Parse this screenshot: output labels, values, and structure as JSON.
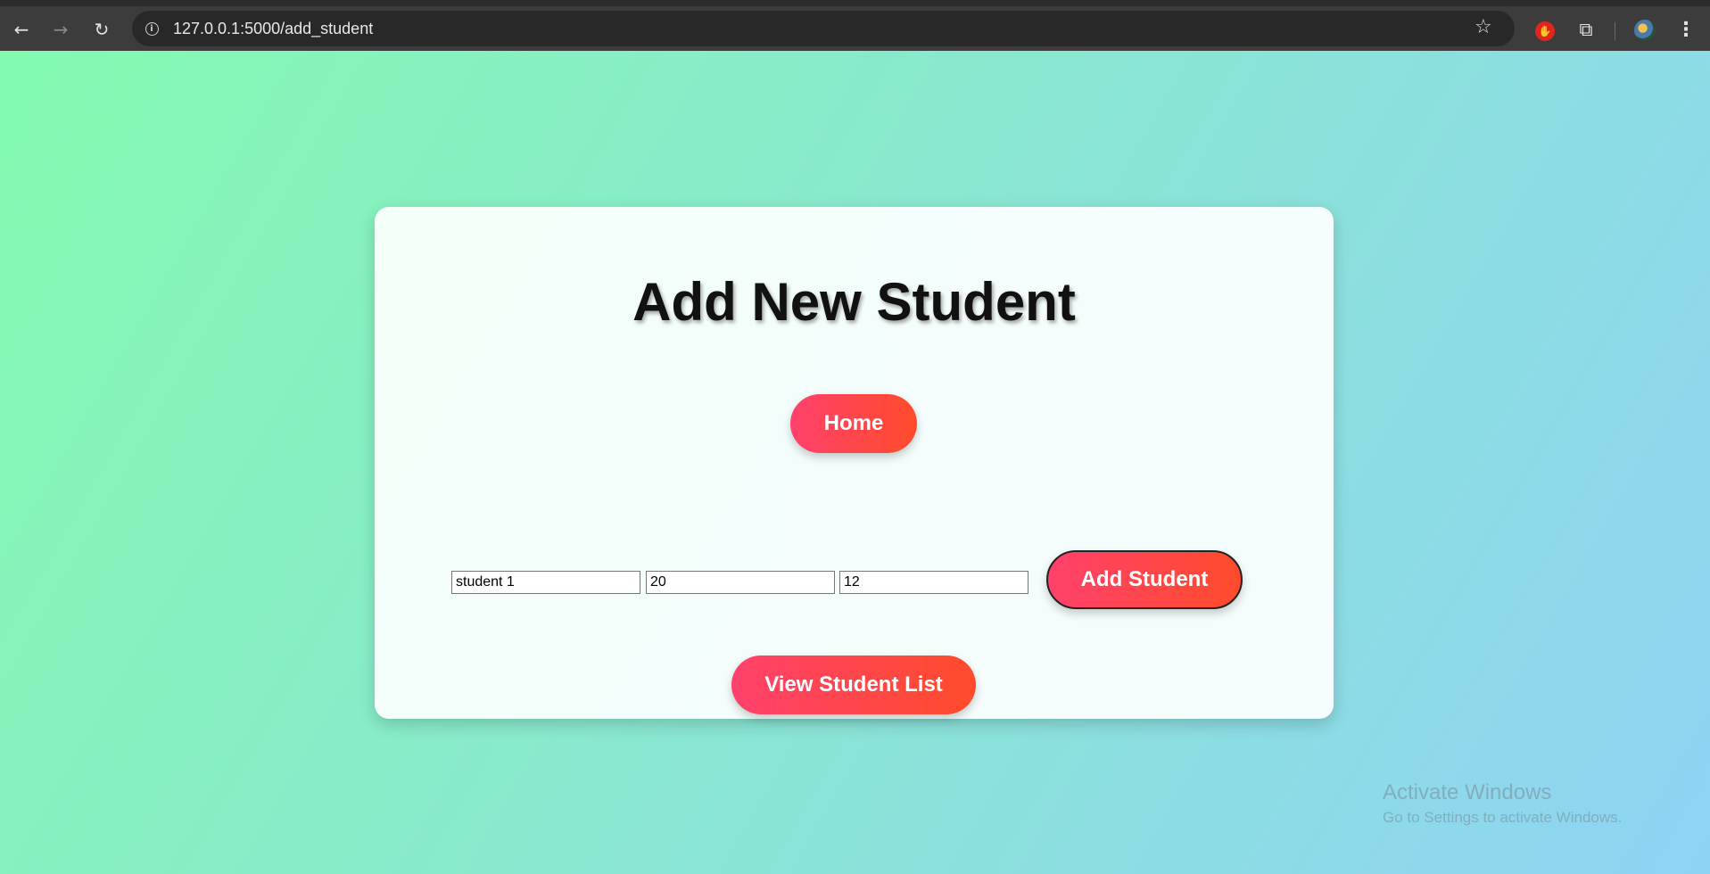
{
  "browser": {
    "url": "127.0.0.1:5000/add_student",
    "icons": {
      "back": "arrow-left-icon",
      "forward": "arrow-right-icon",
      "reload": "reload-icon",
      "site_info": "info-icon",
      "bookmark": "star-icon",
      "extension": "stop-hand-icon",
      "extensions_menu": "puzzle-icon",
      "menu": "kebab-icon"
    }
  },
  "page": {
    "title": "Add New Student",
    "home_label": "Home",
    "fields": {
      "name_value": "student 1",
      "age_value": "20",
      "grade_value": "12"
    },
    "add_label": "Add Student",
    "view_list_label": "View Student List",
    "colors": {
      "background_start": "#84fab0",
      "background_end": "#8fd3f4",
      "button_start": "#ff416c",
      "button_end": "#ff4b2b"
    }
  },
  "os_watermark": {
    "title": "Activate Windows",
    "subtitle": "Go to Settings to activate Windows."
  }
}
